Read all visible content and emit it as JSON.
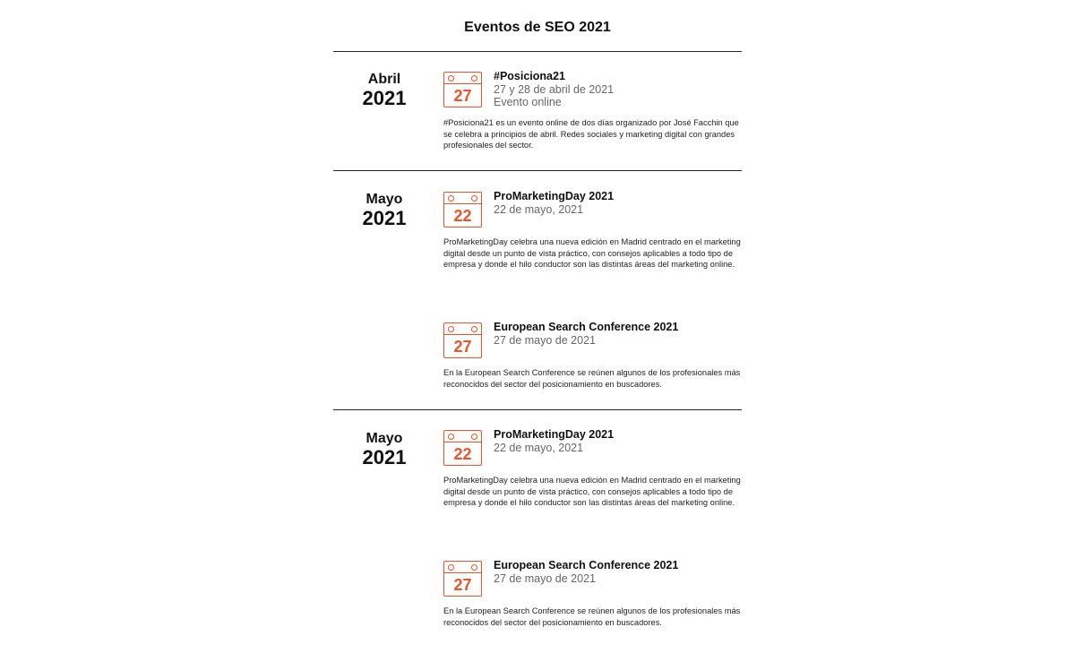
{
  "title": "Eventos de SEO 2021",
  "colors": {
    "accent": "#e8542b",
    "rule": "#222222"
  },
  "sections": [
    {
      "month": "Abril",
      "year": "2021",
      "events": [
        {
          "day": "27",
          "icon": "calendar-icon",
          "title": "#Posiciona21",
          "date": "27 y 28 de abril de 2021",
          "location": "Evento online",
          "description": "#Posiciona21 es un evento online de dos días organizado por José Facchin que se celebra a principios de abril. Redes sociales y marketing digital con grandes profesionales del sector."
        }
      ]
    },
    {
      "month": "Mayo",
      "year": "2021",
      "events": [
        {
          "day": "22",
          "icon": "calendar-icon",
          "title": "ProMarketingDay 2021",
          "date": "22 de mayo, 2021",
          "description": "ProMarketingDay celebra una nueva edición en Madrid centrado en el marketing digital desde un punto de vista práctico, con consejos aplicables a todo tipo de empresa y donde el hilo conductor son las distintas áreas del marketing online."
        },
        {
          "day": "27",
          "icon": "calendar-icon",
          "title": "European Search Conference 2021",
          "date": "27 de mayo de 2021",
          "description": "En la European Search Conference se reúnen algunos de los profesionales más reconocidos del sector del posicionamiento en buscadores."
        }
      ]
    },
    {
      "month": "Mayo",
      "year": "2021",
      "events": [
        {
          "day": "22",
          "icon": "calendar-icon",
          "title": "ProMarketingDay 2021",
          "date": "22 de mayo, 2021",
          "description": "ProMarketingDay celebra una nueva edición en Madrid centrado en el marketing digital desde un punto de vista práctico, con consejos aplicables a todo tipo de empresa y donde el hilo conductor son las distintas áreas del marketing online."
        },
        {
          "day": "27",
          "icon": "calendar-icon",
          "title": "European Search Conference 2021",
          "date": "27 de mayo de 2021",
          "description": "En la European Search Conference se reúnen algunos de los profesionales más reconocidos del sector del posicionamiento en buscadores."
        }
      ]
    }
  ]
}
